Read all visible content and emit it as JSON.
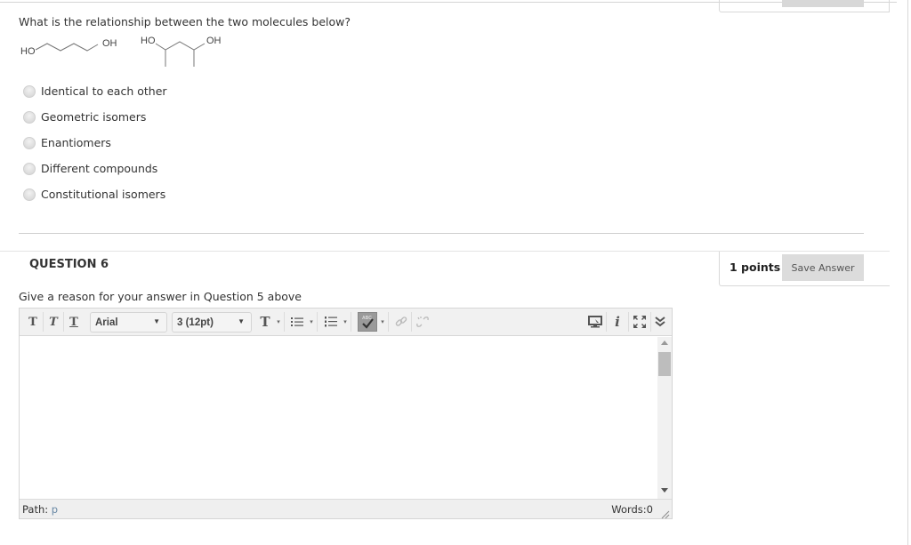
{
  "question5": {
    "prompt": "What is the relationship between the two molecules below?",
    "molecule1": {
      "left_label": "HO",
      "right_label": "OH"
    },
    "molecule2": {
      "left_label": "HO",
      "right_label": "OH"
    },
    "options": [
      {
        "label": "Identical to each other",
        "selected": false
      },
      {
        "label": "Geometric isomers",
        "selected": false
      },
      {
        "label": "Enantiomers",
        "selected": false
      },
      {
        "label": "Different compounds",
        "selected": false
      },
      {
        "label": "Constitutional isomers",
        "selected": false
      }
    ]
  },
  "question6": {
    "title": "QUESTION 6",
    "points": "1 points",
    "save_label": "Save Answer",
    "prompt": "Give a reason for your answer in Question 5 above",
    "editor": {
      "font_family": "Arial",
      "font_size": "3 (12pt)",
      "toolbar_icons": [
        "bold-icon",
        "italic-icon",
        "underline-icon",
        "text-color-icon",
        "bullet-list-icon",
        "numbered-list-icon",
        "spellcheck-icon",
        "link-icon",
        "unlink-icon",
        "preview-icon",
        "info-icon",
        "fullscreen-icon",
        "collapse-icon"
      ],
      "bold_glyph": "T",
      "italic_glyph": "T",
      "underline_glyph": "T",
      "text_color_glyph": "T",
      "drop_glyph": "▾",
      "select_arrow": "▼",
      "content": "",
      "path_label": "Path:",
      "path_value": "p",
      "words_label": "Words:0"
    }
  }
}
